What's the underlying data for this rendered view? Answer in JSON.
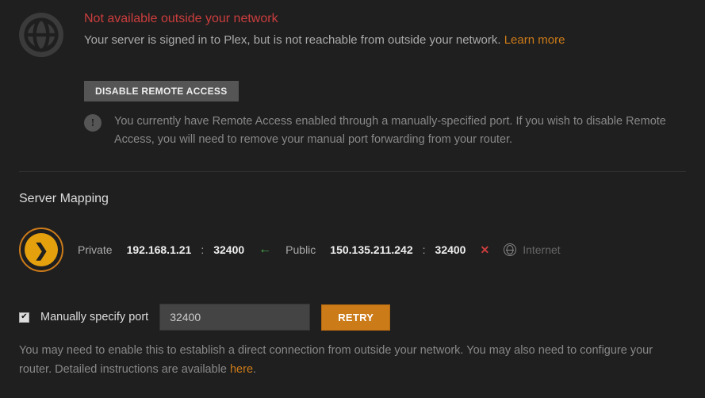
{
  "status": {
    "title": "Not available outside your network",
    "subtitle_prefix": "Your server is signed in to Plex, but is not reachable from outside your network. ",
    "learn_more": "Learn more"
  },
  "disable": {
    "button_label": "DISABLE REMOTE ACCESS",
    "info_text": "You currently have Remote Access enabled through a manually-specified port. If you wish to disable Remote Access, you will need to remove your manual port forwarding from your router."
  },
  "server_mapping": {
    "heading": "Server Mapping",
    "private_label": "Private",
    "private_ip": "192.168.1.21",
    "private_port": "32400",
    "public_label": "Public",
    "public_ip": "150.135.211.242",
    "public_port": "32400",
    "internet_label": "Internet",
    "colon": ":"
  },
  "port": {
    "checkbox_label": "Manually specify port",
    "input_value": "32400",
    "retry_label": "RETRY"
  },
  "help": {
    "text_prefix": "You may need to enable this to establish a direct connection from outside your network. You may also need to configure your router. Detailed instructions are available ",
    "here_label": "here",
    "period": "."
  }
}
